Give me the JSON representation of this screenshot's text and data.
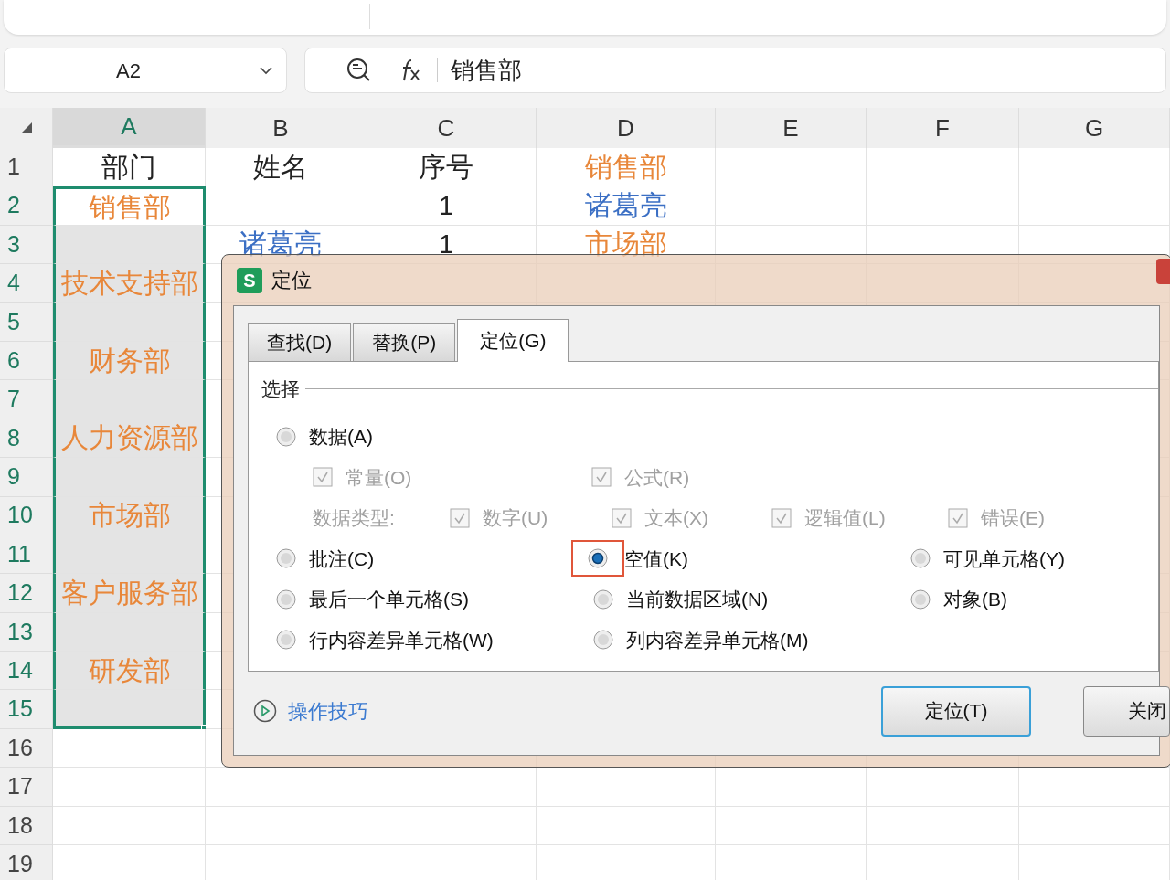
{
  "formula_bar": {
    "name_box": "A2",
    "formula": "销售部"
  },
  "sheet": {
    "columns": [
      {
        "label": "A",
        "selected": true
      },
      {
        "label": "B",
        "selected": false
      },
      {
        "label": "C",
        "selected": false
      },
      {
        "label": "D",
        "selected": false
      },
      {
        "label": "E",
        "selected": false
      },
      {
        "label": "F",
        "selected": false
      },
      {
        "label": "G",
        "selected": false
      }
    ],
    "rows": [
      {
        "label": "1",
        "selected": false,
        "active": false,
        "cells": [
          {
            "text": "部门",
            "color": "#222222"
          },
          {
            "text": "姓名",
            "color": "#222222"
          },
          {
            "text": "序号",
            "color": "#222222"
          },
          {
            "text": "销售部",
            "color": "#e8873a"
          }
        ]
      },
      {
        "label": "2",
        "selected": true,
        "active": true,
        "cells": [
          {
            "text": "销售部",
            "color": "#e8873a"
          },
          "",
          {
            "text": "1",
            "color": "#222222"
          },
          {
            "text": "诸葛亮",
            "color": "#3b6fc4"
          }
        ]
      },
      {
        "label": "3",
        "selected": true,
        "active": false,
        "cells": [
          "",
          {
            "text": "诸葛亮",
            "color": "#3b6fc4"
          },
          {
            "text": "1",
            "color": "#222222"
          },
          {
            "text": "市场部",
            "color": "#e8873a"
          }
        ]
      },
      {
        "label": "4",
        "selected": true,
        "active": false,
        "cells": [
          {
            "text": "技术支持部",
            "color": "#e8873a"
          }
        ]
      },
      {
        "label": "5",
        "selected": true,
        "active": false,
        "cells": []
      },
      {
        "label": "6",
        "selected": true,
        "active": false,
        "cells": [
          {
            "text": "财务部",
            "color": "#e8873a"
          }
        ]
      },
      {
        "label": "7",
        "selected": true,
        "active": false,
        "cells": []
      },
      {
        "label": "8",
        "selected": true,
        "active": false,
        "cells": [
          {
            "text": "人力资源部",
            "color": "#e8873a"
          }
        ]
      },
      {
        "label": "9",
        "selected": true,
        "active": false,
        "cells": []
      },
      {
        "label": "10",
        "selected": true,
        "active": false,
        "cells": [
          {
            "text": "市场部",
            "color": "#e8873a"
          }
        ]
      },
      {
        "label": "11",
        "selected": true,
        "active": false,
        "cells": []
      },
      {
        "label": "12",
        "selected": true,
        "active": false,
        "cells": [
          {
            "text": "客户服务部",
            "color": "#e8873a"
          }
        ]
      },
      {
        "label": "13",
        "selected": true,
        "active": false,
        "cells": []
      },
      {
        "label": "14",
        "selected": true,
        "active": false,
        "cells": [
          {
            "text": "研发部",
            "color": "#e8873a"
          }
        ]
      },
      {
        "label": "15",
        "selected": true,
        "active": false,
        "cells": []
      },
      {
        "label": "16",
        "selected": false,
        "active": false,
        "cells": []
      },
      {
        "label": "17",
        "selected": false,
        "active": false,
        "cells": []
      },
      {
        "label": "18",
        "selected": false,
        "active": false,
        "cells": []
      },
      {
        "label": "19",
        "selected": false,
        "active": false,
        "cells": []
      }
    ]
  },
  "dialog": {
    "app_icon": "S",
    "title": "定位",
    "tabs": [
      {
        "label": "查找(D)",
        "selected": false
      },
      {
        "label": "替换(P)",
        "selected": false
      },
      {
        "label": "定位(G)",
        "selected": true
      }
    ],
    "group_label": "选择",
    "option_rows": [
      {
        "kind": "main",
        "items": [
          {
            "kind": "radio",
            "label": "数据(A)",
            "selected": false,
            "highlighted": false
          }
        ]
      },
      {
        "kind": "sub",
        "items": [
          {
            "kind": "checkbox",
            "label": "常量(O)",
            "checked": true,
            "disabled": true
          },
          {
            "kind": "checkbox",
            "label": "公式(R)",
            "checked": true,
            "disabled": true
          }
        ]
      },
      {
        "kind": "types",
        "items": [
          {
            "kind": "label",
            "label": "数据类型:",
            "disabled": true
          },
          {
            "kind": "checkbox",
            "label": "数字(U)",
            "checked": true,
            "disabled": true
          },
          {
            "kind": "checkbox",
            "label": "文本(X)",
            "checked": true,
            "disabled": true
          },
          {
            "kind": "checkbox",
            "label": "逻辑值(L)",
            "checked": true,
            "disabled": true
          },
          {
            "kind": "checkbox",
            "label": "错误(E)",
            "checked": true,
            "disabled": true
          }
        ]
      },
      {
        "kind": "main",
        "items": [
          {
            "kind": "radio",
            "label": "批注(C)",
            "selected": false,
            "highlighted": false
          },
          {
            "kind": "radio",
            "label": "空值(K)",
            "selected": true,
            "highlighted": true
          },
          {
            "kind": "radio",
            "label": "可见单元格(Y)",
            "selected": false,
            "highlighted": false
          }
        ]
      },
      {
        "kind": "main",
        "items": [
          {
            "kind": "radio",
            "label": "最后一个单元格(S)",
            "selected": false,
            "highlighted": false
          },
          {
            "kind": "radio",
            "label": "当前数据区域(N)",
            "selected": false,
            "highlighted": false
          },
          {
            "kind": "radio",
            "label": "对象(B)",
            "selected": false,
            "highlighted": false
          }
        ]
      },
      {
        "kind": "main",
        "items": [
          {
            "kind": "radio",
            "label": "行内容差异单元格(W)",
            "selected": false,
            "highlighted": false
          },
          {
            "kind": "radio",
            "label": "列内容差异单元格(M)",
            "selected": false,
            "highlighted": false
          }
        ]
      }
    ],
    "tips_link": "操作技巧",
    "buttons": [
      {
        "label": "定位(T)",
        "default": true
      },
      {
        "label": "关闭",
        "default": false
      }
    ]
  }
}
